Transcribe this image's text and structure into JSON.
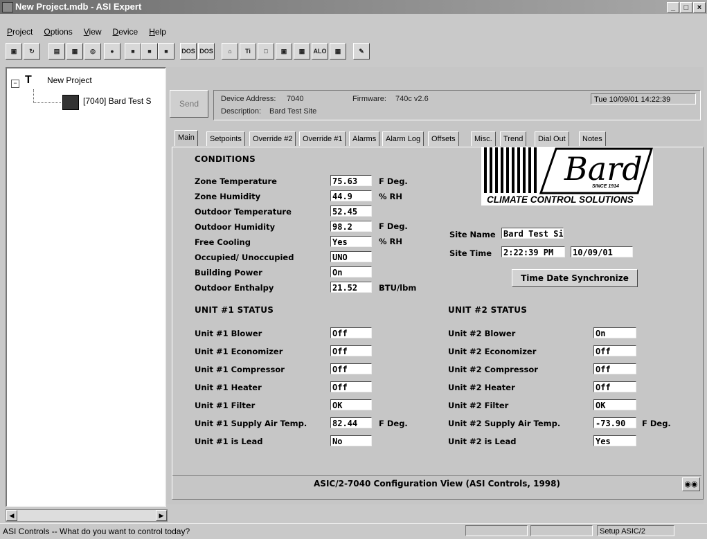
{
  "window": {
    "title": "New Project.mdb - ASI Expert",
    "min": "_",
    "max": "□",
    "close": "×"
  },
  "menu": [
    "Project",
    "Options",
    "View",
    "Device",
    "Help"
  ],
  "toolbar": {
    "buttons": [
      {
        "icon": "window-icon",
        "glyph": "▣"
      },
      {
        "icon": "refresh-icon",
        "glyph": "↻"
      },
      {
        "icon": "doc-icon",
        "glyph": "▤"
      },
      {
        "icon": "chart-icon",
        "glyph": "▦"
      },
      {
        "icon": "binoculars-icon",
        "glyph": "◎"
      },
      {
        "icon": "plug-icon",
        "glyph": "●"
      },
      {
        "icon": "save-icon",
        "glyph": "■"
      },
      {
        "icon": "save-all-icon",
        "glyph": "■"
      },
      {
        "icon": "save-as-icon",
        "glyph": "■"
      },
      {
        "icon": "dos-icon",
        "glyph": "DOS"
      },
      {
        "icon": "dos2-icon",
        "glyph": "DOS"
      },
      {
        "icon": "house-icon",
        "glyph": "⌂"
      },
      {
        "icon": "text-icon",
        "glyph": "Ti"
      },
      {
        "icon": "display-icon",
        "glyph": "□"
      },
      {
        "icon": "panel-icon",
        "glyph": "▣"
      },
      {
        "icon": "grid-icon",
        "glyph": "▦"
      },
      {
        "icon": "alo-icon",
        "glyph": "ALO"
      },
      {
        "icon": "grid2-icon",
        "glyph": "▦"
      },
      {
        "icon": "edit-icon",
        "glyph": "✎"
      }
    ]
  },
  "tree": {
    "root": "New Project",
    "child": "[7040] Bard Test S",
    "root_icon": "network-icon",
    "child_icon": "controller-icon"
  },
  "device": {
    "send": "Send",
    "address_label": "Device Address:",
    "address": "7040",
    "firmware_label": "Firmware:",
    "firmware": "740c v2.6",
    "description_label": "Description:",
    "description": "Bard Test Site",
    "datetime": "Tue 10/09/01 14:22:39"
  },
  "tabs": [
    "Main",
    "Setpoints",
    "Override #2",
    "Override #1",
    "Alarms",
    "Alarm Log",
    "Offsets",
    "Misc.",
    "Trend",
    "Dial Out",
    "Notes"
  ],
  "conditions": {
    "header": "CONDITIONS",
    "rows": [
      {
        "label": "Zone Temperature",
        "value": "75.63",
        "unit": "F Deg."
      },
      {
        "label": "Zone Humidity",
        "value": "44.9",
        "unit": "% RH"
      },
      {
        "label": "Outdoor Temperature",
        "value": "52.45",
        "unit": ""
      },
      {
        "label": "Outdoor Humidity",
        "value": "98.2",
        "unit": ""
      },
      {
        "label": "Free Cooling",
        "value": "Yes",
        "unit": ""
      },
      {
        "label": "Occupied/ Unoccupied",
        "value": "UNO",
        "unit": ""
      },
      {
        "label": "Building Power",
        "value": "On",
        "unit": ""
      },
      {
        "label": "Outdoor Enthalpy",
        "value": "21.52",
        "unit": "BTU/lbm"
      }
    ],
    "outdoor_temp_unit": "F Deg.",
    "outdoor_hum_unit": "% RH"
  },
  "logo": {
    "brand": "Bard",
    "since": "SINCE 1914",
    "tagline": "CLIMATE CONTROL SOLUTIONS"
  },
  "site": {
    "name_label": "Site Name",
    "name": "Bard Test Site",
    "time_label": "Site Time",
    "time": "2:22:39 PM",
    "date": "10/09/01",
    "sync_button": "Time Date Synchronize"
  },
  "unit1": {
    "header": "UNIT #1 STATUS",
    "rows": [
      {
        "label": "Unit #1 Blower",
        "value": "Off",
        "unit": ""
      },
      {
        "label": "Unit #1 Economizer",
        "value": "Off",
        "unit": ""
      },
      {
        "label": "Unit #1 Compressor",
        "value": "Off",
        "unit": ""
      },
      {
        "label": "Unit #1 Heater",
        "value": "Off",
        "unit": ""
      },
      {
        "label": "Unit #1 Filter",
        "value": "OK",
        "unit": ""
      },
      {
        "label": "Unit #1 Supply Air Temp.",
        "value": "82.44",
        "unit": "F Deg."
      },
      {
        "label": "Unit #1 is Lead",
        "value": "No",
        "unit": ""
      }
    ]
  },
  "unit2": {
    "header": "UNIT #2 STATUS",
    "rows": [
      {
        "label": "Unit #2 Blower",
        "value": "On",
        "unit": ""
      },
      {
        "label": "Unit #2 Economizer",
        "value": "Off",
        "unit": ""
      },
      {
        "label": "Unit #2 Compressor",
        "value": "Off",
        "unit": ""
      },
      {
        "label": "Unit #2 Heater",
        "value": "Off",
        "unit": ""
      },
      {
        "label": "Unit #2 Filter",
        "value": "OK",
        "unit": ""
      },
      {
        "label": "Unit #2 Supply Air Temp.",
        "value": "-73.90",
        "unit": "F Deg."
      },
      {
        "label": "Unit #2 is Lead",
        "value": "Yes",
        "unit": ""
      }
    ]
  },
  "footer": "ASIC/2-7040 Configuration View (ASI Controls, 1998)",
  "statusbar": {
    "text": "ASI Controls -- What do you want to control today?",
    "panel": "Setup ASIC/2"
  }
}
